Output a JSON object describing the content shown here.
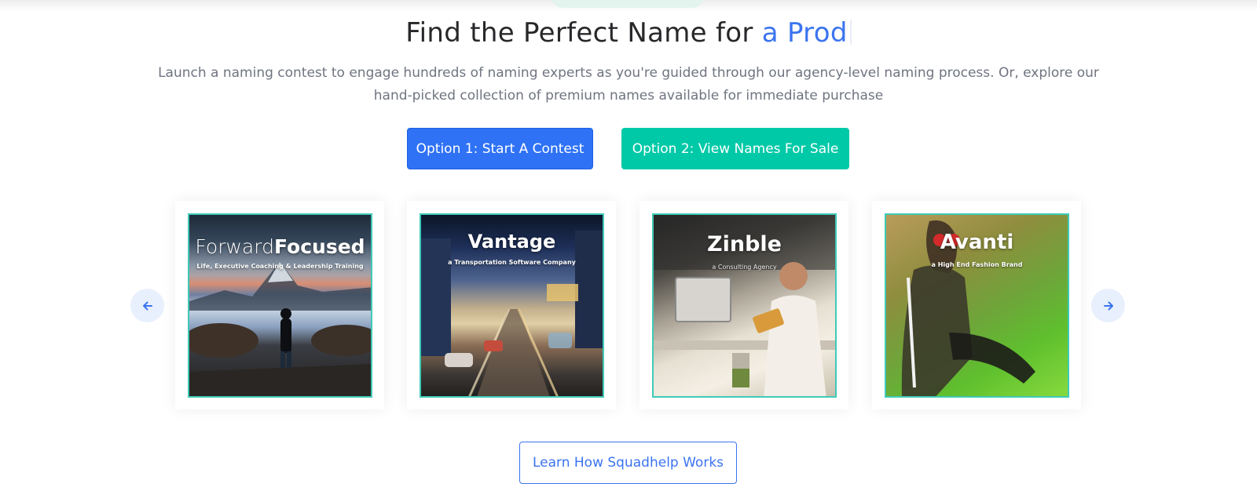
{
  "headline": {
    "text": "Find the Perfect Name for ",
    "highlight": "a Prod"
  },
  "subtitle": "Launch a naming contest to engage hundreds of naming experts as you're guided through our agency-level naming process. Or, explore our hand-picked collection of premium names available for immediate purchase",
  "buttons": {
    "contest": "Option 1: Start A Contest",
    "sale": "Option 2: View Names For Sale",
    "learn": "Learn How Squadhelp Works"
  },
  "carousel": {
    "prev_icon": "arrow-left-icon",
    "next_icon": "arrow-right-icon",
    "cards": [
      {
        "title_a": "Forward",
        "title_b": "Focused",
        "subtitle": "Life, Executive Coaching & Leadership Training"
      },
      {
        "title": "Vantage",
        "subtitle": "a Transportation Software Company"
      },
      {
        "title": "Zinble",
        "subtitle": "a Consulting Agency"
      },
      {
        "title": "Avanti",
        "subtitle": "a High End Fashion Brand"
      }
    ]
  },
  "colors": {
    "accent_blue": "#2f72f6",
    "accent_teal": "#00c9a7",
    "card_border": "#3fcab7"
  }
}
